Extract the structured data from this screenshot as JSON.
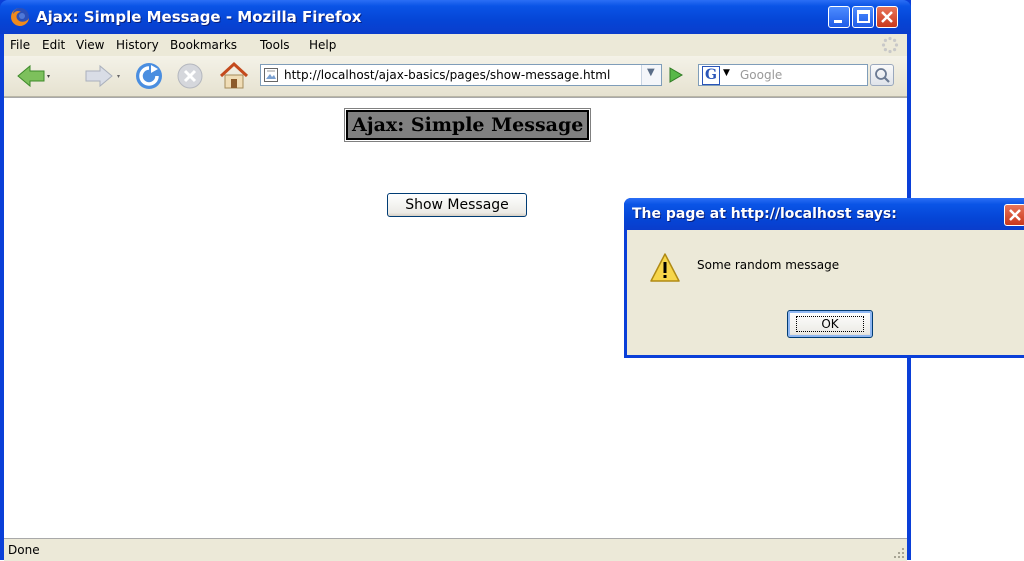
{
  "window": {
    "title": "Ajax: Simple Message - Mozilla Firefox",
    "icon": "firefox-icon"
  },
  "menu": {
    "items": [
      {
        "label": "File"
      },
      {
        "label": "Edit"
      },
      {
        "label": "View"
      },
      {
        "label": "History"
      },
      {
        "label": "Bookmarks"
      },
      {
        "label": "Tools"
      },
      {
        "label": "Help"
      }
    ]
  },
  "toolbar": {
    "url": "http://localhost/ajax-basics/pages/show-message.html",
    "search_placeholder": "Google",
    "search_engine": "G"
  },
  "page": {
    "heading": "Ajax: Simple Message",
    "button_label": "Show Message"
  },
  "status": {
    "text": "Done"
  },
  "dialog": {
    "title": "The page at http://localhost says:",
    "message": "Some random message",
    "ok_label": "OK"
  },
  "colors": {
    "xp_blue": "#0a54e6",
    "chrome": "#ece9d8",
    "close_red": "#c9381c"
  }
}
